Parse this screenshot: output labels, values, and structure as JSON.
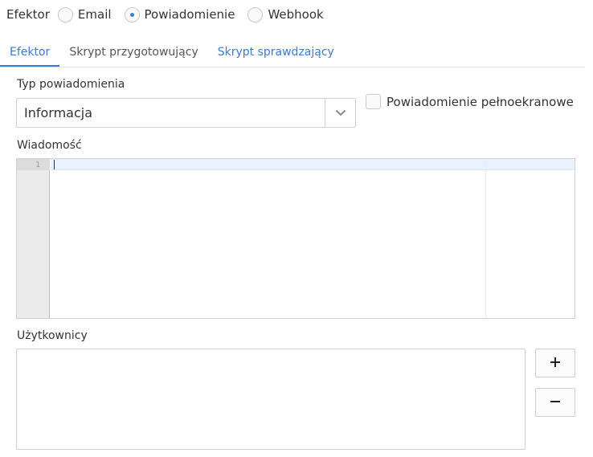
{
  "effector": {
    "label": "Efektor",
    "options": [
      {
        "label": "Email",
        "checked": false
      },
      {
        "label": "Powiadomienie",
        "checked": true
      },
      {
        "label": "Webhook",
        "checked": false
      }
    ]
  },
  "tabs": [
    {
      "label": "Efektor",
      "active": true
    },
    {
      "label": "Skrypt przygotowujący",
      "active": false
    },
    {
      "label": "Skrypt sprawdzający",
      "active": false
    }
  ],
  "notification_type": {
    "label": "Typ powiadomienia",
    "value": "Informacja"
  },
  "fullscreen_checkbox": {
    "label": "Powiadomienie pełnoekranowe",
    "checked": false
  },
  "message": {
    "label": "Wiadomość",
    "line_numbers": [
      "1"
    ]
  },
  "users": {
    "label": "Użytkownicy"
  },
  "colors": {
    "accent": "#3a7bd5",
    "active_line": "#e8f2ff",
    "gutter": "#ebebeb"
  },
  "icons": {
    "select_arrow": "chevron-down-icon",
    "add": "plus-icon",
    "remove": "minus-icon"
  }
}
